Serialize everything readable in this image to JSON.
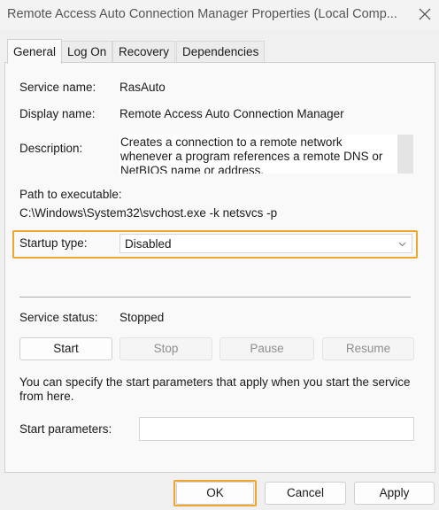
{
  "window": {
    "title": "Remote Access Auto Connection Manager Properties (Local Comp...",
    "close_icon": "close-icon"
  },
  "tabs": [
    {
      "label": "General",
      "active": true
    },
    {
      "label": "Log On",
      "active": false
    },
    {
      "label": "Recovery",
      "active": false
    },
    {
      "label": "Dependencies",
      "active": false
    }
  ],
  "general": {
    "service_name_label": "Service name:",
    "service_name_value": "RasAuto",
    "display_name_label": "Display name:",
    "display_name_value": "Remote Access Auto Connection Manager",
    "description_label": "Description:",
    "description_value": "Creates a connection to a remote network whenever a program references a remote DNS or NetBIOS name or address.",
    "path_label": "Path to executable:",
    "path_value": "C:\\Windows\\System32\\svchost.exe -k netsvcs -p",
    "startup_type_label": "Startup type:",
    "startup_type_value": "Disabled",
    "service_status_label": "Service status:",
    "service_status_value": "Stopped",
    "buttons": {
      "start": "Start",
      "stop": "Stop",
      "pause": "Pause",
      "resume": "Resume"
    },
    "info_text": "You can specify the start parameters that apply when you start the service from here.",
    "start_params_label": "Start parameters:",
    "start_params_value": ""
  },
  "footer": {
    "ok": "OK",
    "cancel": "Cancel",
    "apply": "Apply"
  },
  "colors": {
    "highlight": "#f0a530",
    "window_bg": "#f0f0f0",
    "panel_bg": "#f9f9f9",
    "disabled_text": "#8e8e8e"
  }
}
